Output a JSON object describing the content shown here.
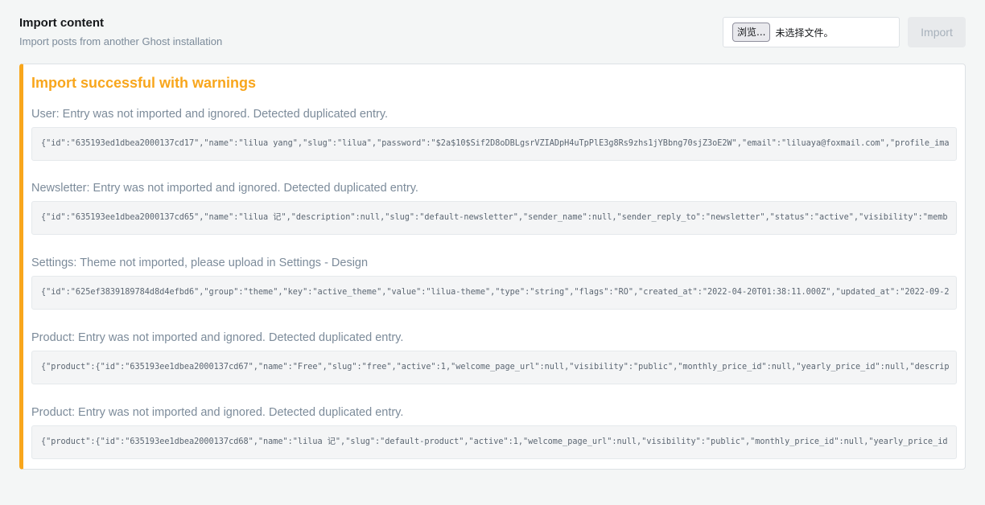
{
  "header": {
    "title": "Import content",
    "description": "Import posts from another Ghost installation",
    "browse_label": "浏览...",
    "file_status": "未选择文件。",
    "import_label": "Import"
  },
  "result": {
    "title": "Import successful with warnings",
    "warnings": [
      {
        "message": "User: Entry was not imported and ignored. Detected duplicated entry.",
        "code": "{\"id\":\"635193ed1dbea2000137cd17\",\"name\":\"lilua yang\",\"slug\":\"lilua\",\"password\":\"$2a$10$Sif2D8oDBLgsrVZIADpH4uTpPlE3g8Rs9zhs1jYBbng70sjZ3oE2W\",\"email\":\"liluaya@foxmail.com\",\"profile_ima"
      },
      {
        "message": "Newsletter: Entry was not imported and ignored. Detected duplicated entry.",
        "code": "{\"id\":\"635193ee1dbea2000137cd65\",\"name\":\"lilua 记\",\"description\":null,\"slug\":\"default-newsletter\",\"sender_name\":null,\"sender_reply_to\":\"newsletter\",\"status\":\"active\",\"visibility\":\"memb"
      },
      {
        "message": "Settings: Theme not imported, please upload in Settings - Design",
        "code": "{\"id\":\"625ef3839189784d8d4efbd6\",\"group\":\"theme\",\"key\":\"active_theme\",\"value\":\"lilua-theme\",\"type\":\"string\",\"flags\":\"RO\",\"created_at\":\"2022-04-20T01:38:11.000Z\",\"updated_at\":\"2022-09-2"
      },
      {
        "message": "Product: Entry was not imported and ignored. Detected duplicated entry.",
        "code": "{\"product\":{\"id\":\"635193ee1dbea2000137cd67\",\"name\":\"Free\",\"slug\":\"free\",\"active\":1,\"welcome_page_url\":null,\"visibility\":\"public\",\"monthly_price_id\":null,\"yearly_price_id\":null,\"descrip"
      },
      {
        "message": "Product: Entry was not imported and ignored. Detected duplicated entry.",
        "code": "{\"product\":{\"id\":\"635193ee1dbea2000137cd68\",\"name\":\"lilua 记\",\"slug\":\"default-product\",\"active\":1,\"welcome_page_url\":null,\"visibility\":\"public\",\"monthly_price_id\":null,\"yearly_price_id"
      }
    ]
  },
  "colors": {
    "warning_accent": "#f8a61c",
    "muted_text": "#7c8b9a"
  }
}
